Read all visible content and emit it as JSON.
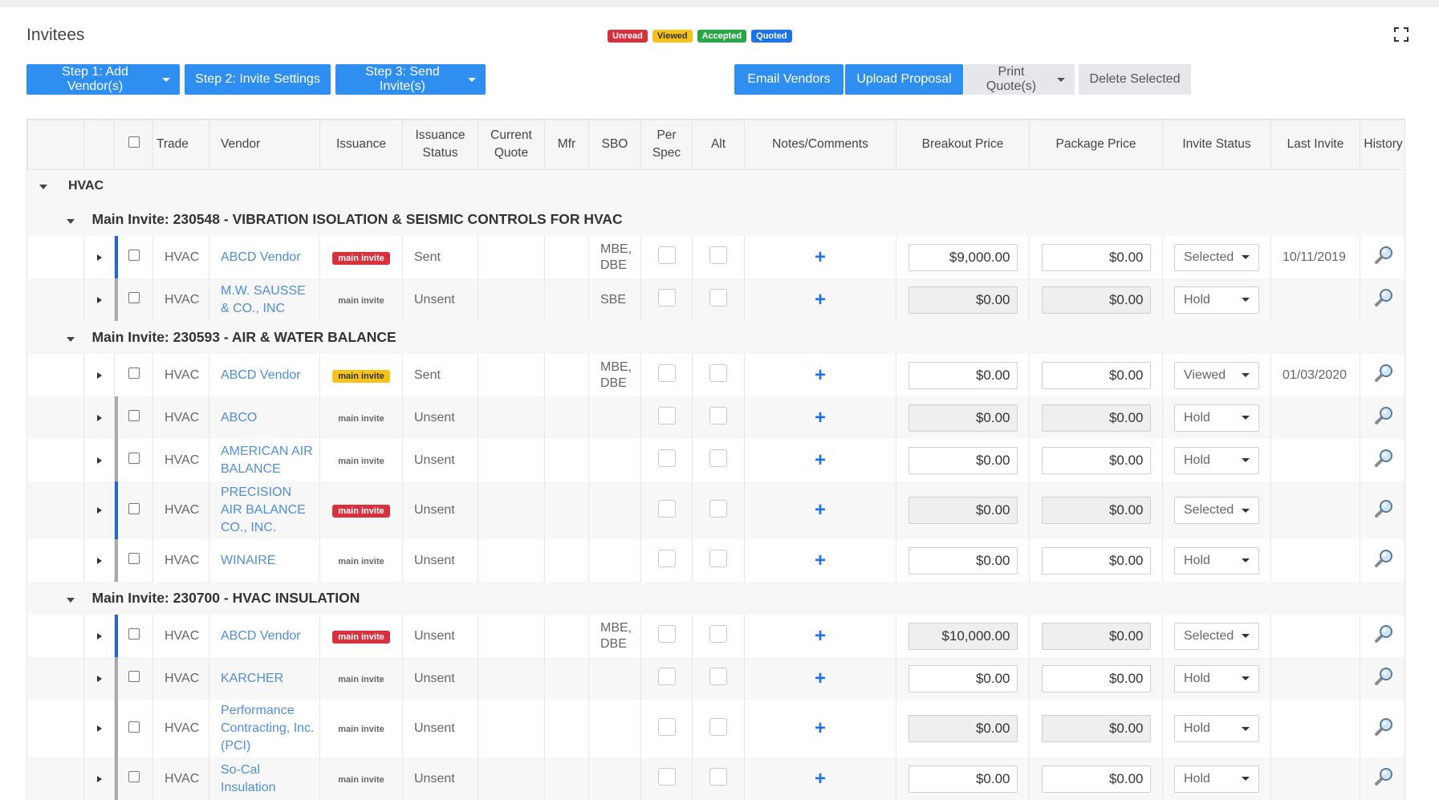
{
  "panel": {
    "title": "Invitees"
  },
  "legend": [
    {
      "label": "Unread",
      "color": "#d9303e"
    },
    {
      "label": "Viewed",
      "color": "#f7c21a"
    },
    {
      "label": "Accepted",
      "color": "#28a745"
    },
    {
      "label": "Quoted",
      "color": "#1a73e8"
    }
  ],
  "toolbar": {
    "step1": "Step 1: Add Vendor(s)",
    "step2": "Step 2: Invite Settings",
    "step3": "Step 3: Send Invite(s)",
    "email_vendors": "Email Vendors",
    "upload_proposal": "Upload Proposal",
    "print_quotes": "Print Quote(s)",
    "delete_selected": "Delete Selected"
  },
  "columns": {
    "trade": "Trade",
    "vendor": "Vendor",
    "issuance": "Issuance",
    "issuance_status_1": "Issuance",
    "issuance_status_2": "Status",
    "current_quote_1": "Current",
    "current_quote_2": "Quote",
    "mfr": "Mfr",
    "sbo": "SBO",
    "per_spec_1": "Per",
    "per_spec_2": "Spec",
    "alt": "Alt",
    "notes": "Notes/Comments",
    "breakout_price": "Breakout Price",
    "package_price": "Package Price",
    "invite_status": "Invite Status",
    "last_invite": "Last Invite",
    "history": "History"
  },
  "trade_group": {
    "name": "HVAC"
  },
  "invites": [
    {
      "title": "Main Invite: 230548 - VIBRATION ISOLATION & SEISMIC CONTROLS FOR HVAC",
      "rows": [
        {
          "trade": "HVAC",
          "vendor": "ABCD Vendor",
          "issuance": "main invite",
          "issuance_style": "red",
          "status": "Sent",
          "sbo": "MBE, DBE",
          "breakout": "$9,000.00",
          "package": "$0.00",
          "invite_status": "Selected",
          "last_invite": "10/11/2019",
          "bar": "blue",
          "breakout_grey": false,
          "package_grey": false
        },
        {
          "trade": "HVAC",
          "vendor": "M.W. SAUSSE & CO., INC",
          "issuance": "main invite",
          "issuance_style": "plain",
          "status": "Unsent",
          "sbo": "SBE",
          "breakout": "$0.00",
          "package": "$0.00",
          "invite_status": "Hold",
          "last_invite": "",
          "bar": "gray",
          "breakout_grey": true,
          "package_grey": true
        }
      ]
    },
    {
      "title": "Main Invite: 230593 - AIR & WATER BALANCE",
      "rows": [
        {
          "trade": "HVAC",
          "vendor": "ABCD Vendor",
          "issuance": "main invite",
          "issuance_style": "yellow",
          "status": "Sent",
          "sbo": "MBE, DBE",
          "breakout": "$0.00",
          "package": "$0.00",
          "invite_status": "Viewed",
          "last_invite": "01/03/2020",
          "bar": "none",
          "breakout_grey": false,
          "package_grey": false
        },
        {
          "trade": "HVAC",
          "vendor": "ABCO",
          "issuance": "main invite",
          "issuance_style": "plain",
          "status": "Unsent",
          "sbo": "",
          "breakout": "$0.00",
          "package": "$0.00",
          "invite_status": "Hold",
          "last_invite": "",
          "bar": "gray",
          "breakout_grey": true,
          "package_grey": true
        },
        {
          "trade": "HVAC",
          "vendor": "AMERICAN AIR BALANCE",
          "issuance": "main invite",
          "issuance_style": "plain",
          "status": "Unsent",
          "sbo": "",
          "breakout": "$0.00",
          "package": "$0.00",
          "invite_status": "Hold",
          "last_invite": "",
          "bar": "gray",
          "breakout_grey": false,
          "package_grey": false
        },
        {
          "trade": "HVAC",
          "vendor": "PRECISION AIR BALANCE CO., INC.",
          "issuance": "main invite",
          "issuance_style": "red",
          "status": "Unsent",
          "sbo": "",
          "breakout": "$0.00",
          "package": "$0.00",
          "invite_status": "Selected",
          "last_invite": "",
          "bar": "blue",
          "breakout_grey": true,
          "package_grey": true
        },
        {
          "trade": "HVAC",
          "vendor": "WINAIRE",
          "issuance": "main invite",
          "issuance_style": "plain",
          "status": "Unsent",
          "sbo": "",
          "breakout": "$0.00",
          "package": "$0.00",
          "invite_status": "Hold",
          "last_invite": "",
          "bar": "gray",
          "breakout_grey": false,
          "package_grey": false
        }
      ]
    },
    {
      "title": "Main Invite: 230700 - HVAC INSULATION",
      "rows": [
        {
          "trade": "HVAC",
          "vendor": "ABCD Vendor",
          "issuance": "main invite",
          "issuance_style": "red",
          "status": "Unsent",
          "sbo": "MBE, DBE",
          "breakout": "$10,000.00",
          "package": "$0.00",
          "invite_status": "Selected",
          "last_invite": "",
          "bar": "blue",
          "breakout_grey": true,
          "package_grey": true
        },
        {
          "trade": "HVAC",
          "vendor": "KARCHER",
          "issuance": "main invite",
          "issuance_style": "plain",
          "status": "Unsent",
          "sbo": "",
          "breakout": "$0.00",
          "package": "$0.00",
          "invite_status": "Hold",
          "last_invite": "",
          "bar": "gray",
          "breakout_grey": false,
          "package_grey": false
        },
        {
          "trade": "HVAC",
          "vendor": "Performance Contracting, Inc. (PCI)",
          "issuance": "main invite",
          "issuance_style": "plain",
          "status": "Unsent",
          "sbo": "",
          "breakout": "$0.00",
          "package": "$0.00",
          "invite_status": "Hold",
          "last_invite": "",
          "bar": "gray",
          "breakout_grey": true,
          "package_grey": true
        },
        {
          "trade": "HVAC",
          "vendor": "So-Cal Insulation",
          "issuance": "main invite",
          "issuance_style": "plain",
          "status": "Unsent",
          "sbo": "",
          "breakout": "$0.00",
          "package": "$0.00",
          "invite_status": "Hold",
          "last_invite": "",
          "bar": "gray",
          "breakout_grey": false,
          "package_grey": false
        }
      ]
    }
  ]
}
